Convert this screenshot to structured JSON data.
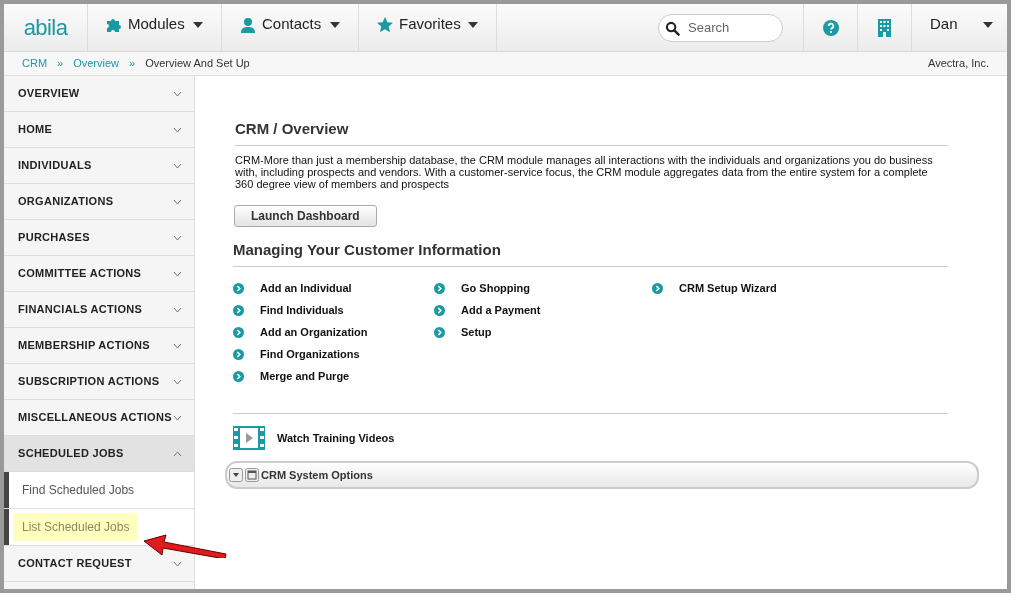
{
  "nav": {
    "logo": "abila",
    "menus": [
      {
        "label": "Modules",
        "kind": "modules"
      },
      {
        "label": "Contacts",
        "kind": "contacts"
      },
      {
        "label": "Favorites",
        "kind": "favorites"
      }
    ],
    "search": {
      "placeholder": "Search"
    },
    "user": "Dan"
  },
  "breadcrumb": {
    "items": [
      "CRM",
      "Overview",
      "Overview And Set Up"
    ],
    "separator": "»",
    "organization": "Avectra, Inc."
  },
  "sidebar": {
    "items": [
      {
        "label": "OVERVIEW",
        "expanded": false
      },
      {
        "label": "HOME",
        "expanded": false
      },
      {
        "label": "INDIVIDUALS",
        "expanded": false
      },
      {
        "label": "ORGANIZATIONS",
        "expanded": false
      },
      {
        "label": "PURCHASES",
        "expanded": false
      },
      {
        "label": "COMMITTEE ACTIONS",
        "expanded": false
      },
      {
        "label": "FINANCIALS ACTIONS",
        "expanded": false
      },
      {
        "label": "MEMBERSHIP ACTIONS",
        "expanded": false
      },
      {
        "label": "SUBSCRIPTION ACTIONS",
        "expanded": false
      },
      {
        "label": "MISCELLANEOUS ACTIONS",
        "expanded": false
      },
      {
        "label": "SCHEDULED JOBS",
        "expanded": true,
        "children": [
          {
            "label": "Find Scheduled Jobs",
            "selected": false
          },
          {
            "label": "List Scheduled Jobs",
            "selected": true
          }
        ]
      },
      {
        "label": "CONTACT REQUEST",
        "expanded": false
      }
    ]
  },
  "main": {
    "title": "CRM / Overview",
    "description": "CRM-More than just a membership database, the CRM module manages all interactions with the individuals and organizations you do business with, including prospects and vendors. With a customer-service focus, the CRM module aggregates data from the entire system for a complete 360 degree view of members and prospects",
    "button": "Launch Dashboard",
    "section_title": "Managing Your Customer Information",
    "link_columns": [
      [
        "Add an Individual",
        "Find Individuals",
        "Add an Organization",
        "Find Organizations",
        "Merge and Purge"
      ],
      [
        "Go Shopping",
        "Add a Payment",
        "Setup"
      ],
      [
        "CRM Setup Wizard"
      ]
    ],
    "videos": "Watch Training Videos",
    "panel": "CRM System Options"
  }
}
